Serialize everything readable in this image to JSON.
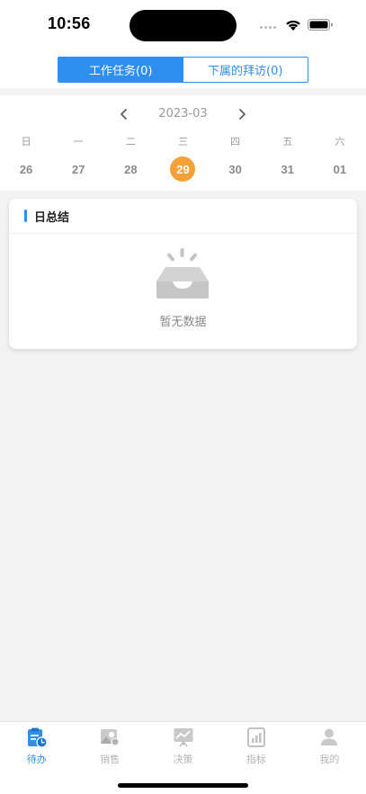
{
  "status": {
    "time": "10:56"
  },
  "segmented": {
    "tabs": [
      {
        "label": "工作任务(0)",
        "active": true
      },
      {
        "label": "下属的拜访(0)",
        "active": false
      }
    ]
  },
  "calendar": {
    "month": "2023-03",
    "weekdays": [
      "日",
      "一",
      "二",
      "三",
      "四",
      "五",
      "六"
    ],
    "dates": [
      "26",
      "27",
      "28",
      "29",
      "30",
      "31",
      "01"
    ],
    "selected": "29"
  },
  "summary": {
    "title": "日总结",
    "empty_text": "暂无数据"
  },
  "tabbar": {
    "items": [
      {
        "label": "待办",
        "icon": "todo-icon",
        "active": true
      },
      {
        "label": "销售",
        "icon": "sales-icon",
        "active": false
      },
      {
        "label": "决策",
        "icon": "decision-icon",
        "active": false
      },
      {
        "label": "指标",
        "icon": "metrics-icon",
        "active": false
      },
      {
        "label": "我的",
        "icon": "profile-icon",
        "active": false
      }
    ]
  },
  "colors": {
    "accent": "#2f8ff0",
    "today": "#f5a13a",
    "background": "#f3f3f3"
  }
}
